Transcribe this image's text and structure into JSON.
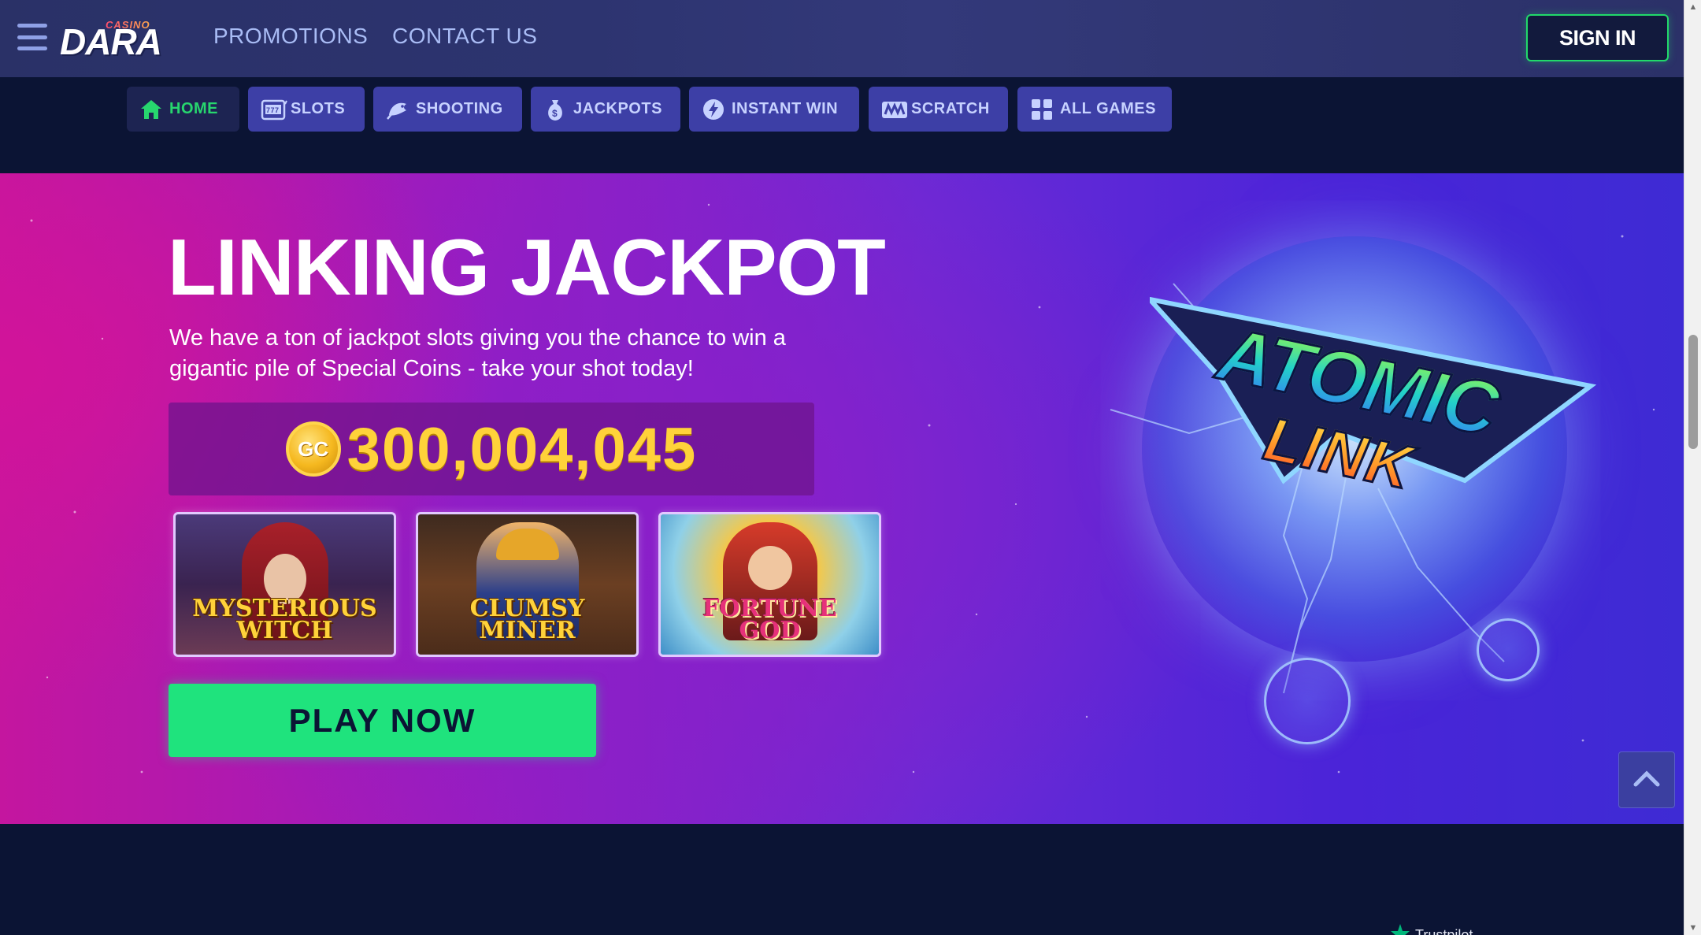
{
  "header": {
    "logo_small": "CASINO",
    "logo_main": "DARA",
    "nav": [
      {
        "label": "PROMOTIONS"
      },
      {
        "label": "CONTACT US"
      }
    ],
    "signin_label": "SIGN IN"
  },
  "categories": [
    {
      "label": "HOME",
      "icon": "home-icon",
      "active": true
    },
    {
      "label": "SLOTS",
      "icon": "slot-machine-icon",
      "active": false
    },
    {
      "label": "SHOOTING",
      "icon": "fish-icon",
      "active": false
    },
    {
      "label": "JACKPOTS",
      "icon": "money-bag-icon",
      "active": false
    },
    {
      "label": "INSTANT WIN",
      "icon": "lightning-icon",
      "active": false
    },
    {
      "label": "SCRATCH",
      "icon": "scratch-card-icon",
      "active": false
    },
    {
      "label": "ALL GAMES",
      "icon": "grid-icon",
      "active": false
    }
  ],
  "hero": {
    "title": "LINKING JACKPOT",
    "description": "We have a ton of jackpot slots giving you the chance to win a gigantic pile of Special Coins - take your shot today!",
    "coin_label": "GC",
    "jackpot_amount": "300,004,045",
    "games": [
      {
        "name": "MYSTERIOUS WITCH",
        "line1": "MYSTERIOUS",
        "line2": "WITCH"
      },
      {
        "name": "CLUMSY MINER",
        "line1": "CLUMSY",
        "line2": "MINER"
      },
      {
        "name": "FORTUNE GOD",
        "line1": "FORTUNE",
        "line2": "GOD"
      }
    ],
    "cta_label": "PLAY NOW",
    "art_title_line1": "ATOMIC",
    "art_title_line2": "LINK"
  },
  "footer_peek": {
    "trustpilot_label": "Trustpilot"
  },
  "colors": {
    "accent_green": "#1fe37d",
    "jackpot_gold": "#ffd23a",
    "pill_bg": "#3d3fa6",
    "page_bg": "#0b1434"
  }
}
